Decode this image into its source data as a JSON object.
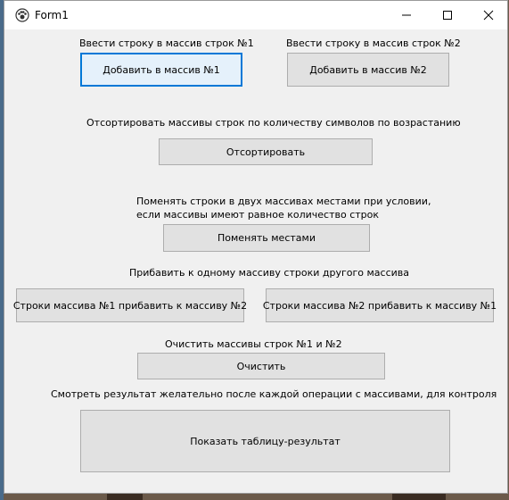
{
  "window": {
    "title": "Form1"
  },
  "section1": {
    "label1": "Ввести строку в массив строк №1",
    "label2": "Ввести строку в массив строк №2",
    "btn1": "Добавить в массив №1",
    "btn2": "Добавить в массив №2"
  },
  "section2": {
    "label": "Отсортировать массивы строк по количеству символов по возрастанию",
    "btn": "Отсортировать"
  },
  "section3": {
    "label_line1": "Поменять строки в двух массивах местами при условии,",
    "label_line2": "если массивы имеют равное количество строк",
    "btn": "Поменять местами"
  },
  "section4": {
    "label": "Прибавить к одному массиву строки другого массива",
    "btn1": "Строки массива №1 прибавить к массиву №2",
    "btn2": "Строки массива №2 прибавить к массиву №1"
  },
  "section5": {
    "label": "Очистить массивы строк №1 и №2",
    "btn": "Очистить"
  },
  "section6": {
    "label": "Смотреть результат желательно после каждой операции с массивами, для контроля",
    "btn": "Показать таблицу-результат"
  }
}
